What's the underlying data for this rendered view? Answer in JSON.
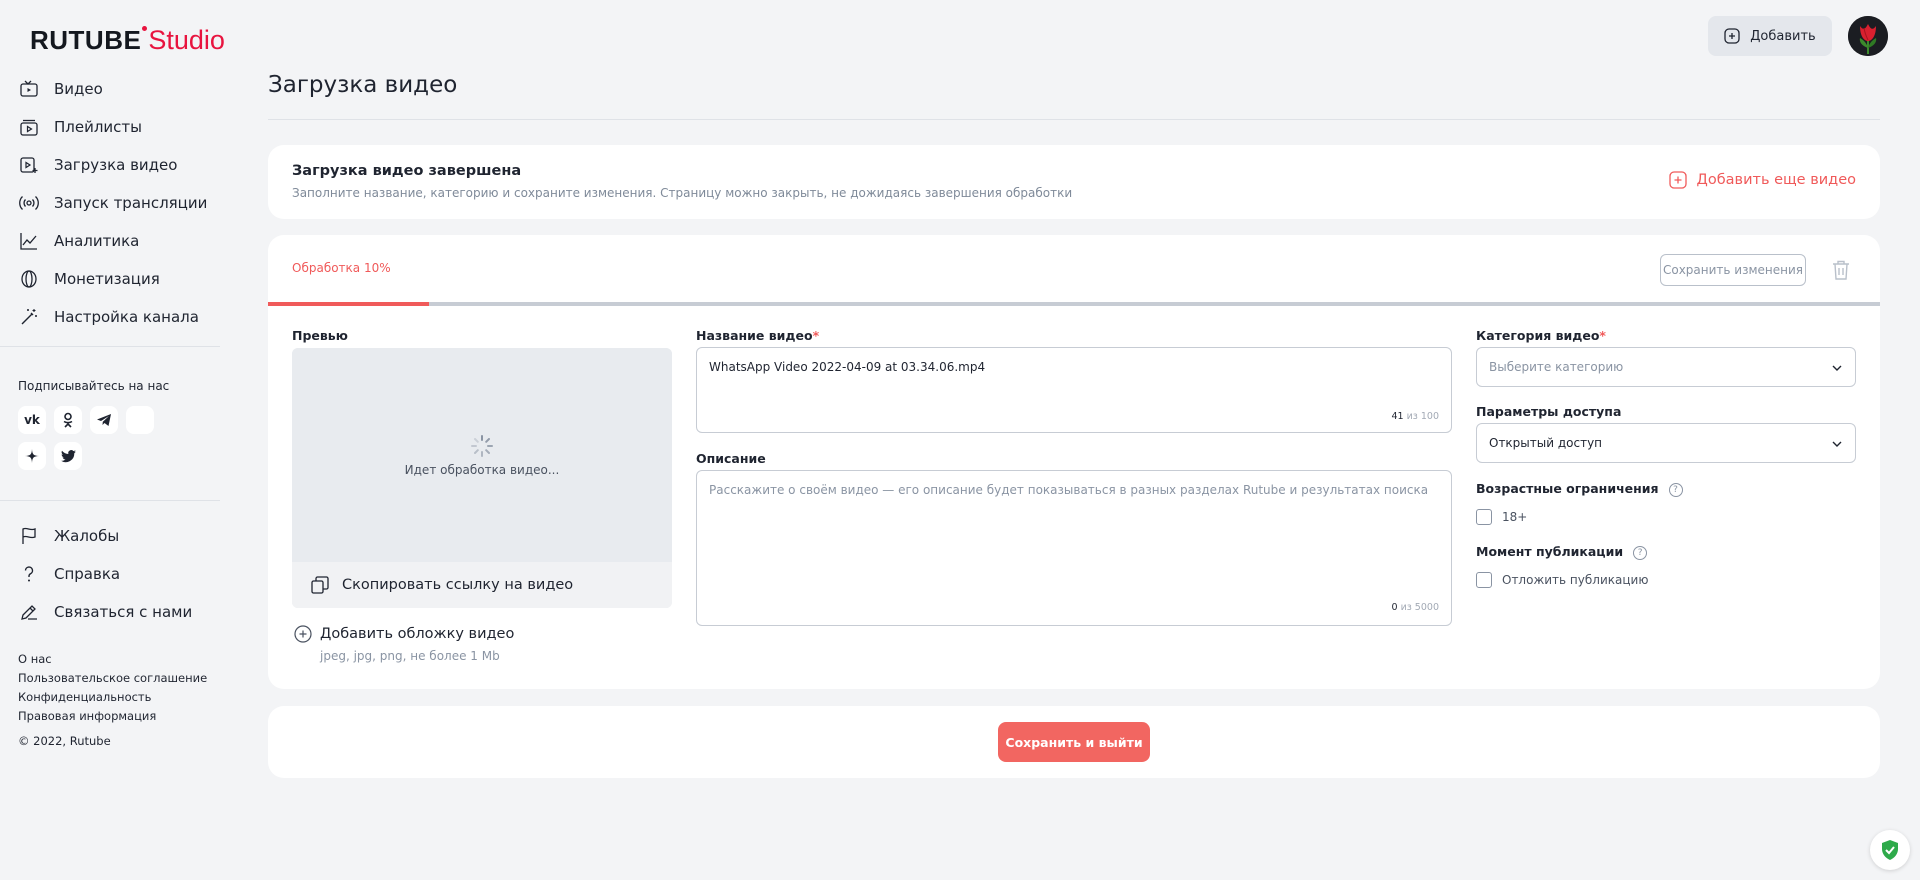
{
  "header": {
    "logo_main": "RUTUBE",
    "logo_sub": "Studio",
    "add_label": "Добавить"
  },
  "sidebar": {
    "items": [
      {
        "label": "Видео",
        "icon": "video-icon"
      },
      {
        "label": "Плейлисты",
        "icon": "playlist-icon"
      },
      {
        "label": "Загрузка видео",
        "icon": "upload-icon"
      },
      {
        "label": "Запуск трансляции",
        "icon": "broadcast-icon"
      },
      {
        "label": "Аналитика",
        "icon": "analytics-icon"
      },
      {
        "label": "Монетизация",
        "icon": "coin-icon"
      },
      {
        "label": "Настройка канала",
        "icon": "magic-wand-icon"
      }
    ],
    "follow_title": "Подписывайтесь на нас",
    "socials_row1": [
      "vk-icon",
      "ok-icon",
      "telegram-icon",
      "blank-icon"
    ],
    "socials_row2": [
      "zen-icon",
      "twitter-icon"
    ],
    "support_items": [
      {
        "label": "Жалобы",
        "icon": "flag-icon"
      },
      {
        "label": "Справка",
        "icon": "question-icon"
      },
      {
        "label": "Связаться с нами",
        "icon": "edit-icon"
      }
    ],
    "footer_links": [
      "О нас",
      "Пользовательское соглашение",
      "Конфиденциальность",
      "Правовая информация"
    ],
    "copyright": "© 2022, Rutube"
  },
  "main": {
    "page_title": "Загрузка видео",
    "upload_done": {
      "title": "Загрузка видео завершена",
      "subtitle": "Заполните название, категорию и сохраните изменения. Страницу можно закрыть, не дожидаясь завершения обработки",
      "add_more": "Добавить еще видео"
    },
    "editor": {
      "processing_label": "Обработка 10%",
      "processing_progress": 0.1,
      "save_changes": "Сохранить изменения",
      "preview_label": "Превью",
      "preview_status": "Идет обработка видео...",
      "copy_link": "Скопировать ссылку на видео",
      "add_cover": "Добавить обложку видео",
      "cover_hint": "jpeg, jpg, png, не более 1 Mb",
      "title_label": "Название видео",
      "required_mark": "*",
      "title_value": "WhatsApp Video 2022-04-09 at 03.34.06.mp4",
      "title_count": "41",
      "title_max": "из 100",
      "description_label": "Описание",
      "description_placeholder": "Расскажите о своём видео — его описание будет показываться в разных разделах Rutube и результатах поиска",
      "description_count": "0",
      "description_max": "из 5000",
      "category_label": "Категория видео",
      "category_placeholder": "Выберите категорию",
      "access_label": "Параметры доступа",
      "access_value": "Открытый доступ",
      "age_label": "Возрастные ограничения",
      "age_option": "18+",
      "publish_label": "Момент публикации",
      "publish_option": "Отложить публикацию",
      "help_glyph": "?"
    },
    "save_exit": "Сохранить и выйти"
  },
  "colors": {
    "accent": "#f05a5a",
    "brand": "#e8143f"
  }
}
